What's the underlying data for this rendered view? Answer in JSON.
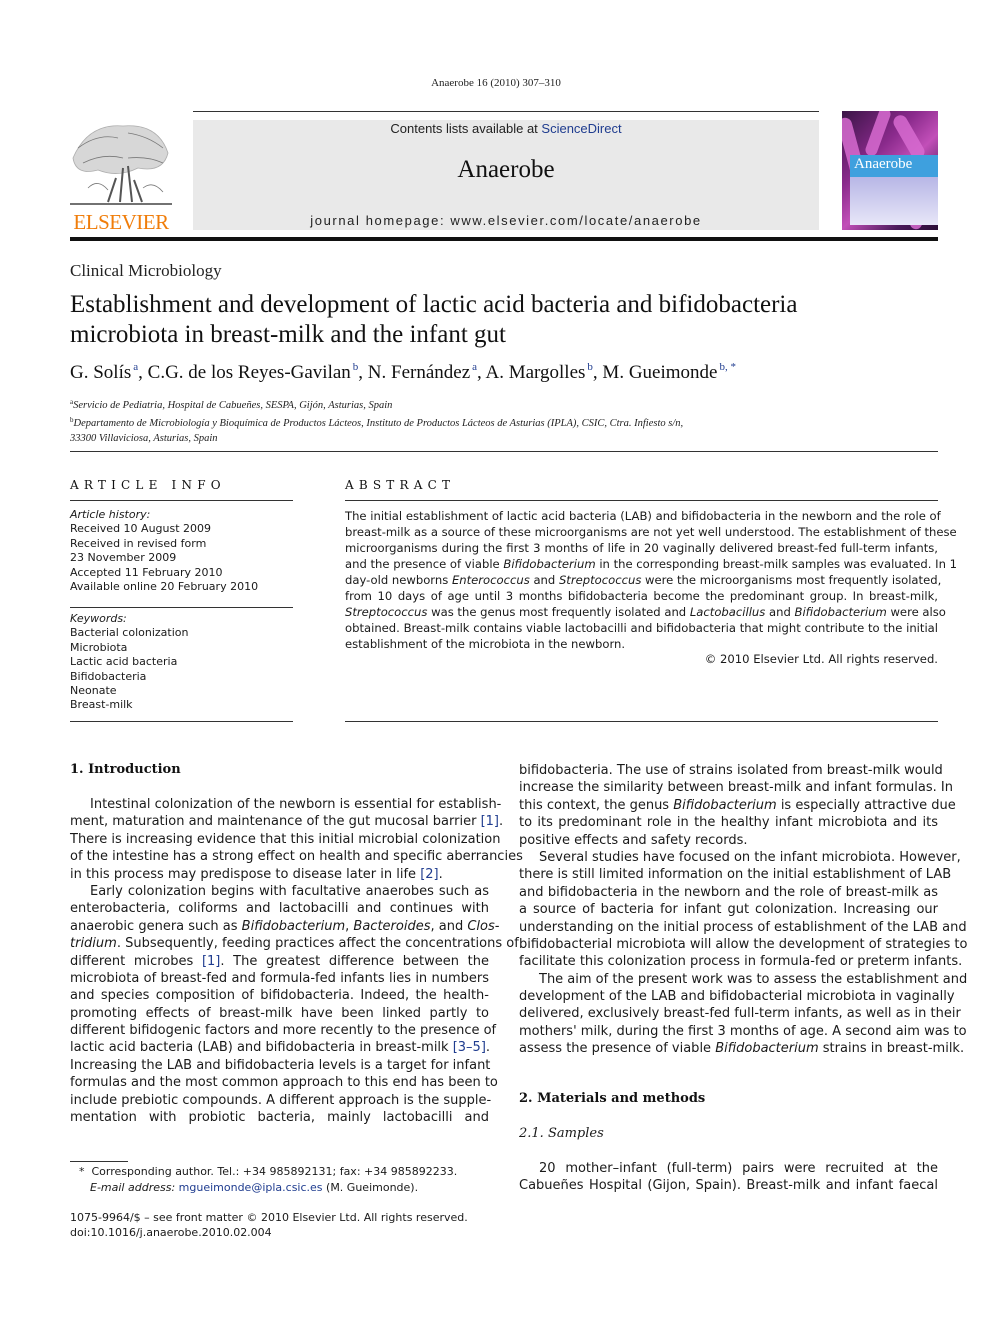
{
  "header": {
    "running_head": "Anaerobe 16 (2010) 307–310",
    "contents_prefix": "Contents lists available at ",
    "contents_link": "ScienceDirect",
    "journal_title": "Anaerobe",
    "homepage": "journal homepage: www.elsevier.com/locate/anaerobe",
    "publisher_logo": "ELSEVIER",
    "cover_title": "Anaerobe"
  },
  "colors": {
    "elsevier_orange": "#f07d0a",
    "link_blue": "#1f3c8f",
    "masthead_gray": "#e9e9e9",
    "cover_band_blue": "#3ea0de"
  },
  "article": {
    "section": "Clinical Microbiology",
    "title_lines": [
      "Establishment and development of lactic acid bacteria and bifidobacteria",
      "microbiota in breast-milk and the infant gut"
    ],
    "authors": [
      {
        "name": "G. Solís",
        "sup": "a"
      },
      {
        "name": "C.G. de los Reyes-Gavilan",
        "sup": "b"
      },
      {
        "name": "N. Fernández",
        "sup": "a"
      },
      {
        "name": "A. Margolles",
        "sup": "b"
      },
      {
        "name": "M. Gueimonde",
        "sup": "b, *"
      }
    ],
    "affiliations": [
      {
        "sup": "a",
        "lines": [
          "Servicio de Pediatria, Hospital de Cabueñes, SESPA, Gijón, Asturias, Spain"
        ]
      },
      {
        "sup": "b",
        "lines": [
          "Departamento de Microbiología y Bioquímica de Productos Lácteos, Instituto de Productos Lácteos de Asturias (IPLA), CSIC, Ctra. Infiesto s/n,",
          "33300 Villaviciosa, Asturias, Spain"
        ]
      }
    ]
  },
  "article_info": {
    "heading": "ARTICLE INFO",
    "history_label": "Article history:",
    "history": [
      "Received 10 August 2009",
      "Received in revised form",
      "23 November 2009",
      "Accepted 11 February 2010",
      "Available online 20 February 2010"
    ],
    "keywords_label": "Keywords:",
    "keywords": [
      "Bacterial colonization",
      "Microbiota",
      "Lactic acid bacteria",
      "Bifidobacteria",
      "Neonate",
      "Breast-milk"
    ]
  },
  "abstract": {
    "heading": "ABSTRACT",
    "lines": [
      [
        "The initial establishment of lactic acid bacteria (LAB) and bifidobacteria in the newborn and the role of"
      ],
      [
        "breast-milk as a source of these microorganisms are not yet well understood. The establishment of these"
      ],
      [
        "microorganisms during the first 3 months of life in 20 vaginally delivered breast-fed full-term infants,"
      ],
      [
        "and the presence of viable ",
        {
          "i": "Bifidobacterium"
        },
        " in the corresponding breast-milk samples was evaluated. In 1"
      ],
      [
        "day-old newborns ",
        {
          "i": "Enterococcus"
        },
        " and ",
        {
          "i": "Streptococcus"
        },
        " were the microorganisms most frequently isolated,"
      ],
      [
        "from 10 days of age until 3 months bifidobacteria become the predominant group. In breast-milk,"
      ],
      [
        {
          "i": "Streptococcus"
        },
        " was the genus most frequently isolated and ",
        {
          "i": "Lactobacillus"
        },
        " and ",
        {
          "i": "Bifidobacterium"
        },
        " were also"
      ],
      [
        "obtained. Breast-milk contains viable lactobacilli and bifidobacteria that might contribute to the initial"
      ],
      [
        "establishment of the microbiota in the newborn."
      ]
    ],
    "copyright": "© 2010 Elsevier Ltd. All rights reserved."
  },
  "body": {
    "intro_heading": "1.  Introduction",
    "left_lines": [
      {
        "ind": true,
        "parts": [
          "Intestinal colonization of the newborn is essential for establish-"
        ]
      },
      {
        "parts": [
          "ment, maturation and maintenance of the gut mucosal barrier ",
          {
            "ref": "[1]"
          },
          "."
        ]
      },
      {
        "parts": [
          "There is increasing evidence that this initial microbial colonization"
        ]
      },
      {
        "parts": [
          "of the intestine has a strong effect on health and specific aberrancies"
        ]
      },
      {
        "last": true,
        "parts": [
          "in this process may predispose to disease later in life ",
          {
            "ref": "[2]"
          },
          "."
        ]
      },
      {
        "ind": true,
        "parts": [
          "Early colonization begins with facultative anaerobes such as"
        ]
      },
      {
        "parts": [
          "enterobacteria, coliforms and lactobacilli and continues with"
        ]
      },
      {
        "parts": [
          "anaerobic genera such as ",
          {
            "i": "Bifidobacterium"
          },
          ", ",
          {
            "i": "Bacteroides"
          },
          ", and ",
          {
            "i": "Clos-"
          }
        ]
      },
      {
        "parts": [
          {
            "i": "tridium"
          },
          ". Subsequently, feeding practices affect the concentrations of"
        ]
      },
      {
        "parts": [
          "different microbes ",
          {
            "ref": "[1]"
          },
          ". The greatest difference between the"
        ]
      },
      {
        "parts": [
          "microbiota of breast-fed and formula-fed infants lies in numbers"
        ]
      },
      {
        "parts": [
          "and species composition of bifidobacteria. Indeed, the health-"
        ]
      },
      {
        "parts": [
          "promoting effects of breast-milk have been linked partly to"
        ]
      },
      {
        "parts": [
          "different bifidogenic factors and more recently to the presence of"
        ]
      },
      {
        "parts": [
          "lactic acid bacteria (LAB) and bifidobacteria in breast-milk ",
          {
            "ref": "[3–5]"
          },
          "."
        ]
      },
      {
        "parts": [
          "Increasing the LAB and bifidobacteria levels is a target for infant"
        ]
      },
      {
        "parts": [
          "formulas and the most common approach to this end has been to"
        ]
      },
      {
        "parts": [
          "include prebiotic compounds. A different approach is the supple-"
        ]
      },
      {
        "parts": [
          "mentation with probiotic bacteria, mainly lactobacilli and"
        ]
      }
    ],
    "right_lines": [
      {
        "parts": [
          "bifidobacteria. The use of strains isolated from breast-milk would"
        ]
      },
      {
        "parts": [
          "increase the similarity between breast-milk and infant formulas. In"
        ]
      },
      {
        "parts": [
          "this context, the genus ",
          {
            "i": "Bifidobacterium"
          },
          " is especially attractive due"
        ]
      },
      {
        "parts": [
          "to its predominant role in the healthy infant microbiota and its"
        ]
      },
      {
        "last": true,
        "parts": [
          "positive effects and safety records."
        ]
      },
      {
        "ind": true,
        "parts": [
          "Several studies have focused on the infant microbiota. However,"
        ]
      },
      {
        "parts": [
          "there is still limited information on the initial establishment of LAB"
        ]
      },
      {
        "parts": [
          "and bifidobacteria in the newborn and the role of breast-milk as"
        ]
      },
      {
        "parts": [
          "a source of bacteria for infant gut colonization. Increasing our"
        ]
      },
      {
        "parts": [
          "understanding on the initial process of establishment of the LAB and"
        ]
      },
      {
        "parts": [
          "bifidobacterial microbiota will allow the development of strategies to"
        ]
      },
      {
        "last": true,
        "parts": [
          "facilitate this colonization process in formula-fed or preterm infants."
        ]
      },
      {
        "ind": true,
        "parts": [
          "The aim of the present work was to assess the establishment and"
        ]
      },
      {
        "parts": [
          "development of the LAB and bifidobacterial microbiota in vaginally"
        ]
      },
      {
        "parts": [
          "delivered, exclusively breast-fed full-term infants, as well as in their"
        ]
      },
      {
        "parts": [
          "mothers' milk, during the first 3 months of age. A second aim was to"
        ]
      },
      {
        "last": true,
        "parts": [
          "assess the presence of viable ",
          {
            "i": "Bifidobacterium"
          },
          " strains in breast-milk."
        ]
      }
    ],
    "methods_heading": "2.  Materials and methods",
    "subsection_heading": "2.1.  Samples",
    "samples_lines": [
      {
        "ind": true,
        "parts": [
          "20 mother–infant (full-term) pairs were recruited at the"
        ]
      },
      {
        "parts": [
          "Cabueñes Hospital (Gijon, Spain). Breast-milk and infant faecal"
        ]
      }
    ]
  },
  "footnote": {
    "marker": "*",
    "text": "Corresponding author. Tel.: +34 985892131; fax: +34 985892233.",
    "email_label": "E-mail address:",
    "email": "mgueimonde@ipla.csic.es",
    "email_owner": " (M. Gueimonde)."
  },
  "front_matter": {
    "issn_line": "1075-9964/$ – see front matter © 2010 Elsevier Ltd. All rights reserved.",
    "doi": "doi:10.1016/j.anaerobe.2010.02.004"
  }
}
